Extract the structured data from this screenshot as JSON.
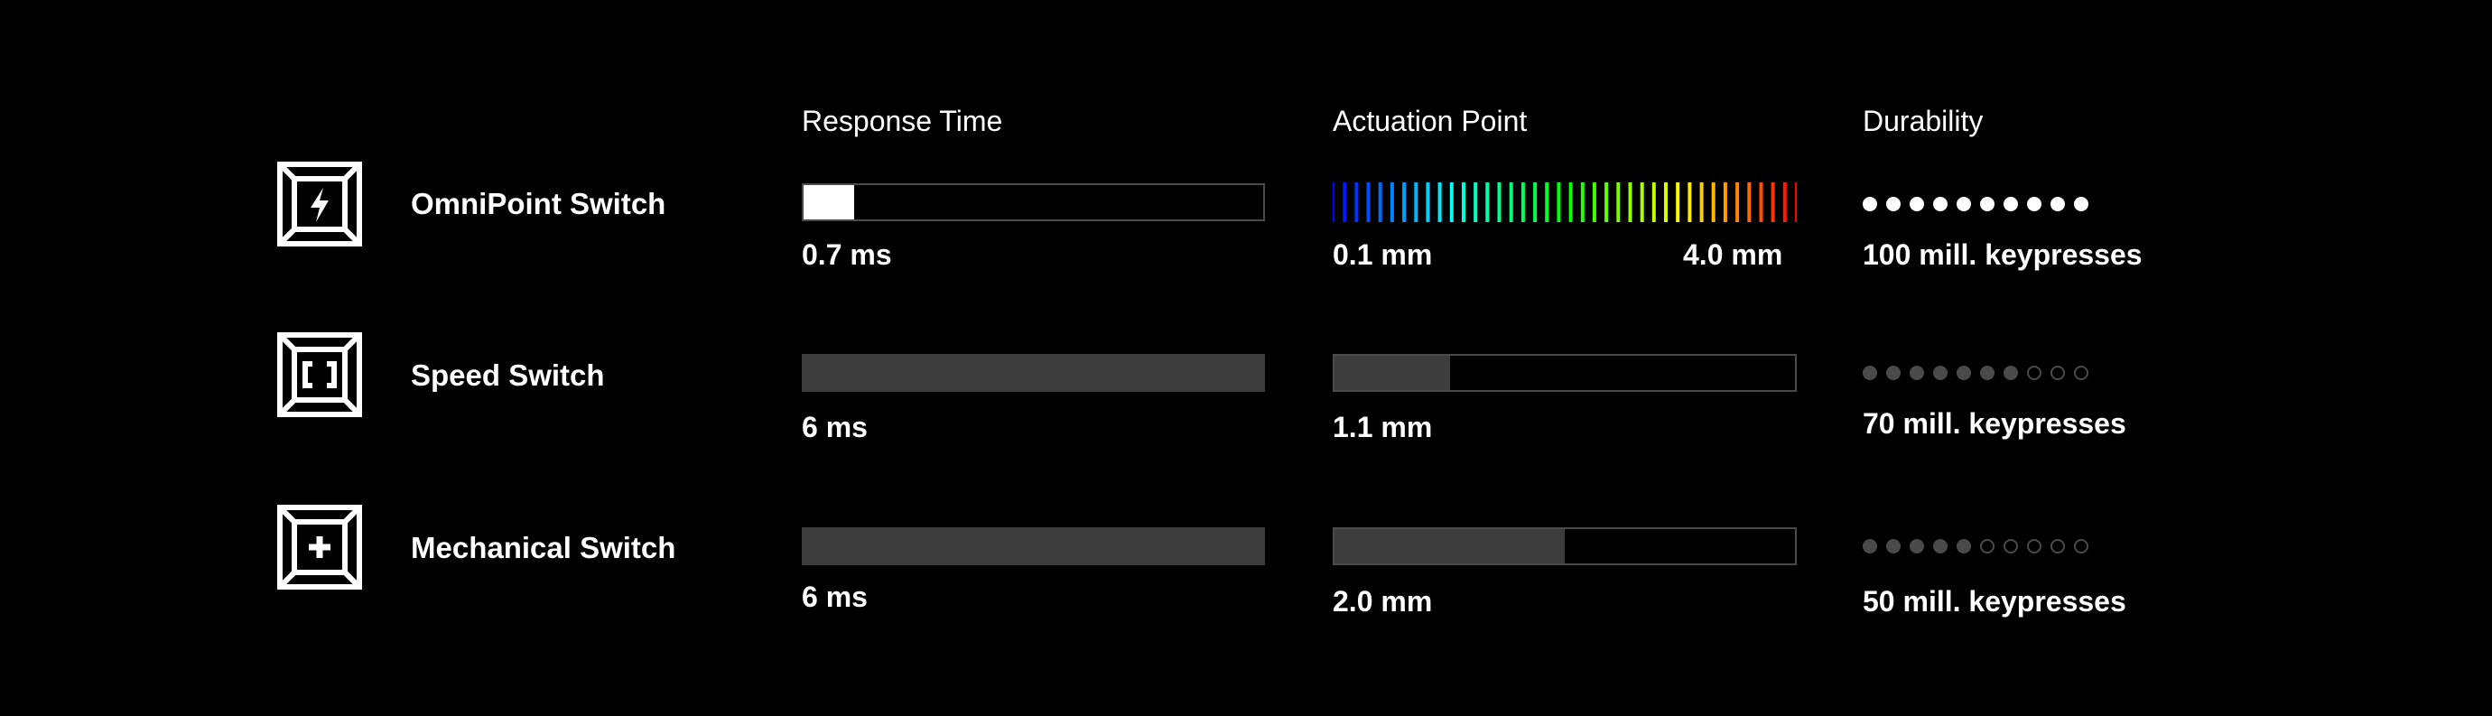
{
  "columns": {
    "response_time": "Response Time",
    "actuation_point": "Actuation Point",
    "durability": "Durability"
  },
  "rows": [
    {
      "icon": "lightning-icon",
      "name": "OmniPoint Switch",
      "response": {
        "label": "0.7 ms",
        "fill_fraction": 0.11,
        "fill_color": "#ffffff"
      },
      "actuation": {
        "type": "range",
        "min_label": "0.1 mm",
        "max_label": "4.0 mm"
      },
      "durability": {
        "label": "100 mill. keypresses",
        "filled": 10,
        "total": 10,
        "dot_color": "#ffffff"
      }
    },
    {
      "icon": "bracket-square-icon",
      "name": "Speed Switch",
      "response": {
        "label": "6 ms",
        "fill_fraction": 1.0,
        "fill_color": "#3d3d3d"
      },
      "actuation": {
        "type": "bar",
        "label": "1.1 mm",
        "fill_fraction": 0.25,
        "fill_color": "#3d3d3d"
      },
      "durability": {
        "label": "70 mill. keypresses",
        "filled": 7,
        "total": 10,
        "dot_color": "#4a4a4a"
      }
    },
    {
      "icon": "plus-icon",
      "name": "Mechanical Switch",
      "response": {
        "label": "6 ms",
        "fill_fraction": 1.0,
        "fill_color": "#3d3d3d"
      },
      "actuation": {
        "type": "bar",
        "label": "2.0 mm",
        "fill_fraction": 0.5,
        "fill_color": "#3d3d3d"
      },
      "durability": {
        "label": "50 mill. keypresses",
        "filled": 5,
        "total": 10,
        "dot_color": "#4a4a4a"
      }
    }
  ],
  "colors": {
    "background": "#000000",
    "text": "#ffffff",
    "bar_border": "#4a4a4a",
    "bar_fill": "#3d3d3d"
  }
}
